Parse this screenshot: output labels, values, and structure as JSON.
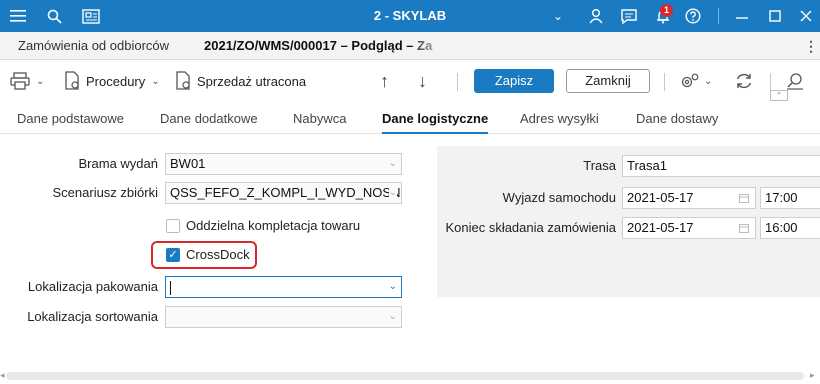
{
  "window": {
    "title": "2 - SKYLAB",
    "notification_count": "1"
  },
  "doc_tabs": {
    "tab1": "Zamówienia od odbiorców",
    "tab2": "2021/ZO/WMS/000017 – Podgląd – Za"
  },
  "toolbar": {
    "procedures_label": "Procedury",
    "lost_sale_label": "Sprzedaż utracona",
    "save_label": "Zapisz",
    "close_label": "Zamknij"
  },
  "subtabs": [
    "Dane podstawowe",
    "Dane dodatkowe",
    "Nabywca",
    "Dane logistyczne",
    "Adres wysyłki",
    "Dane dostawy"
  ],
  "form": {
    "gate": {
      "label": "Brama wydań",
      "value": "BW01"
    },
    "scenario": {
      "label": "Scenariusz zbiórki",
      "value": "QSS_FEFO_Z_KOMPL_I_WYD_NOSN"
    },
    "separate_picking": {
      "label": "Oddzielna kompletacja towaru",
      "checked": false
    },
    "crossdock": {
      "label": "CrossDock",
      "checked": true
    },
    "packing_location": {
      "label": "Lokalizacja pakowania",
      "value": ""
    },
    "sorting_location": {
      "label": "Lokalizacja sortowania",
      "value": ""
    }
  },
  "right_panel": {
    "route": {
      "label": "Trasa",
      "value": "Trasa1"
    },
    "departure": {
      "label": "Wyjazd samochodu",
      "date": "2021-05-17",
      "time": "17:00"
    },
    "order_end": {
      "label": "Koniec składania zamówienia",
      "date": "2021-05-17",
      "time": "16:00"
    }
  },
  "colors": {
    "accent": "#1a7bc2",
    "highlight": "#d9262f"
  }
}
